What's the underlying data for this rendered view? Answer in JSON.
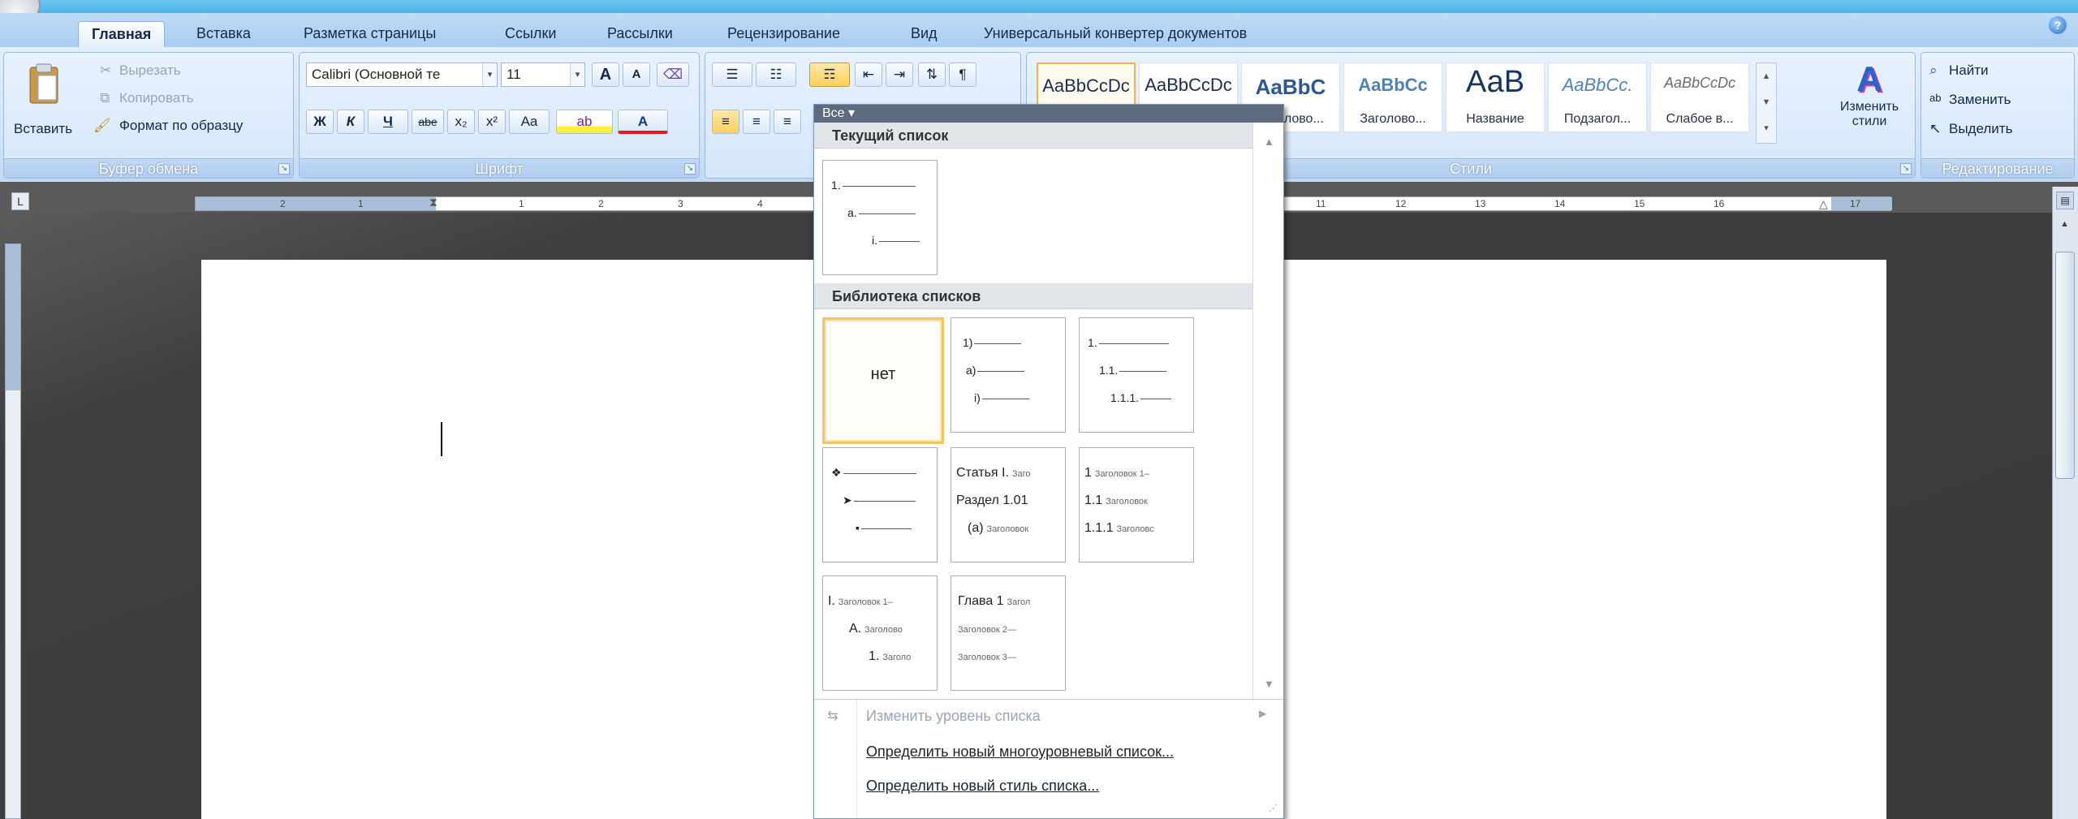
{
  "tabs": [
    "Главная",
    "Вставка",
    "Разметка страницы",
    "Ссылки",
    "Рассылки",
    "Рецензирование",
    "Вид",
    "Универсальный конвертер документов"
  ],
  "help_glyph": "?",
  "clipboard": {
    "paste": "Вставить",
    "cut": "Вырезать",
    "copy": "Копировать",
    "format_painter": "Формат по образцу",
    "group_label": "Буфер обмена"
  },
  "font": {
    "font_name": "Calibri (Основной те",
    "font_size": "11",
    "bold": "Ж",
    "italic": "К",
    "underline": "Ч",
    "strike": "abe",
    "subscript": "x₂",
    "superscript": "x²",
    "change_case": "Aa",
    "grow": "A",
    "shrink": "A",
    "group_label": "Шрифт"
  },
  "styles": {
    "tiles": [
      {
        "sample": "AaBbCcDc",
        "name": ""
      },
      {
        "sample": "AaBbCcDc",
        "name": ""
      },
      {
        "sample": "AaBbC",
        "name": "Заголово..."
      },
      {
        "sample": "AaBbCc",
        "name": "Заголово..."
      },
      {
        "sample": "АаВ",
        "name": "Название"
      },
      {
        "sample": "AaBbCc.",
        "name": "Подзагол..."
      },
      {
        "sample": "AaBbCcDc",
        "name": "Слабое в..."
      }
    ],
    "change_styles": "Изменить стили",
    "group_label": "Стили"
  },
  "editing": {
    "find": "Найти",
    "replace": "Заменить",
    "select": "Выделить",
    "group_label": "Редактирование"
  },
  "ruler": {
    "left_marks": [
      "2",
      "1"
    ],
    "right_marks": [
      "1",
      "2",
      "3",
      "4",
      "11",
      "12",
      "13",
      "14",
      "15",
      "16",
      "17"
    ]
  },
  "dropdown": {
    "filter": "Все ▾",
    "current_list_header": "Текущий список",
    "current_list": [
      "1.",
      "a.",
      "i."
    ],
    "library_header": "Библиотека списков",
    "none_label": "нет",
    "tile_paren": [
      "1)",
      "a)",
      "i)"
    ],
    "tile_decimal": [
      "1.",
      "1.1.",
      "1.1.1."
    ],
    "tile_bullets": [
      "❖",
      "➤",
      "▪"
    ],
    "tile_article": [
      {
        "lead": "Статья I.",
        "rest": "Заго"
      },
      {
        "lead": "Раздел 1.01",
        "rest": ""
      },
      {
        "lead": "(a)",
        "rest": "Заголовок"
      }
    ],
    "tile_heading_nums": [
      {
        "lead": "1",
        "rest": "Заголовок 1–"
      },
      {
        "lead": "1.1",
        "rest": "Заголовок"
      },
      {
        "lead": "1.1.1",
        "rest": "Заголовс"
      }
    ],
    "tile_roman": [
      {
        "lead": "I.",
        "rest": "Заголовок 1–"
      },
      {
        "lead": "A.",
        "rest": "Заголово"
      },
      {
        "lead": "1.",
        "rest": "Заголо"
      }
    ],
    "tile_chapter": [
      {
        "lead": "Глава 1",
        "rest": "Загол"
      },
      {
        "lead": "",
        "rest": "Заголовок 2—"
      },
      {
        "lead": "",
        "rest": "Заголовок 3—"
      }
    ],
    "menu": {
      "change_level": "Изменить уровень списка",
      "define_multilevel": "Определить новый многоуровневый список...",
      "define_style": "Определить новый стиль списка..."
    }
  }
}
